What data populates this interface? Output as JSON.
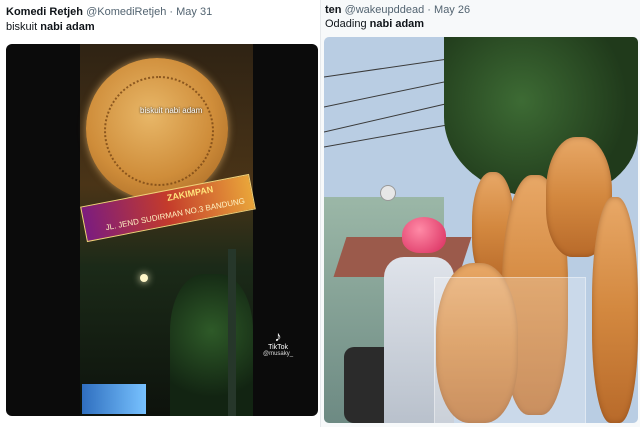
{
  "tweets": [
    {
      "author": "Komedi Retjeh",
      "handle": "@KomediRetjeh",
      "separator": "·",
      "date": "May 31",
      "text_prefix": "biskuit ",
      "text_bold": "nabi adam",
      "media": {
        "overlay_text": "biskuit nabi adam",
        "sign_title": "ZAKIMPAN",
        "sign_subtitle": "JL. JEND SUDIRMAN NO.3 BANDUNG",
        "watermark": "TikTok",
        "watermark_user": "@musaky_"
      }
    },
    {
      "author": "ten",
      "handle": "@wakeupddead",
      "separator": "·",
      "date": "May 26",
      "text_prefix": "Odading ",
      "text_bold": "nabi adam"
    }
  ]
}
